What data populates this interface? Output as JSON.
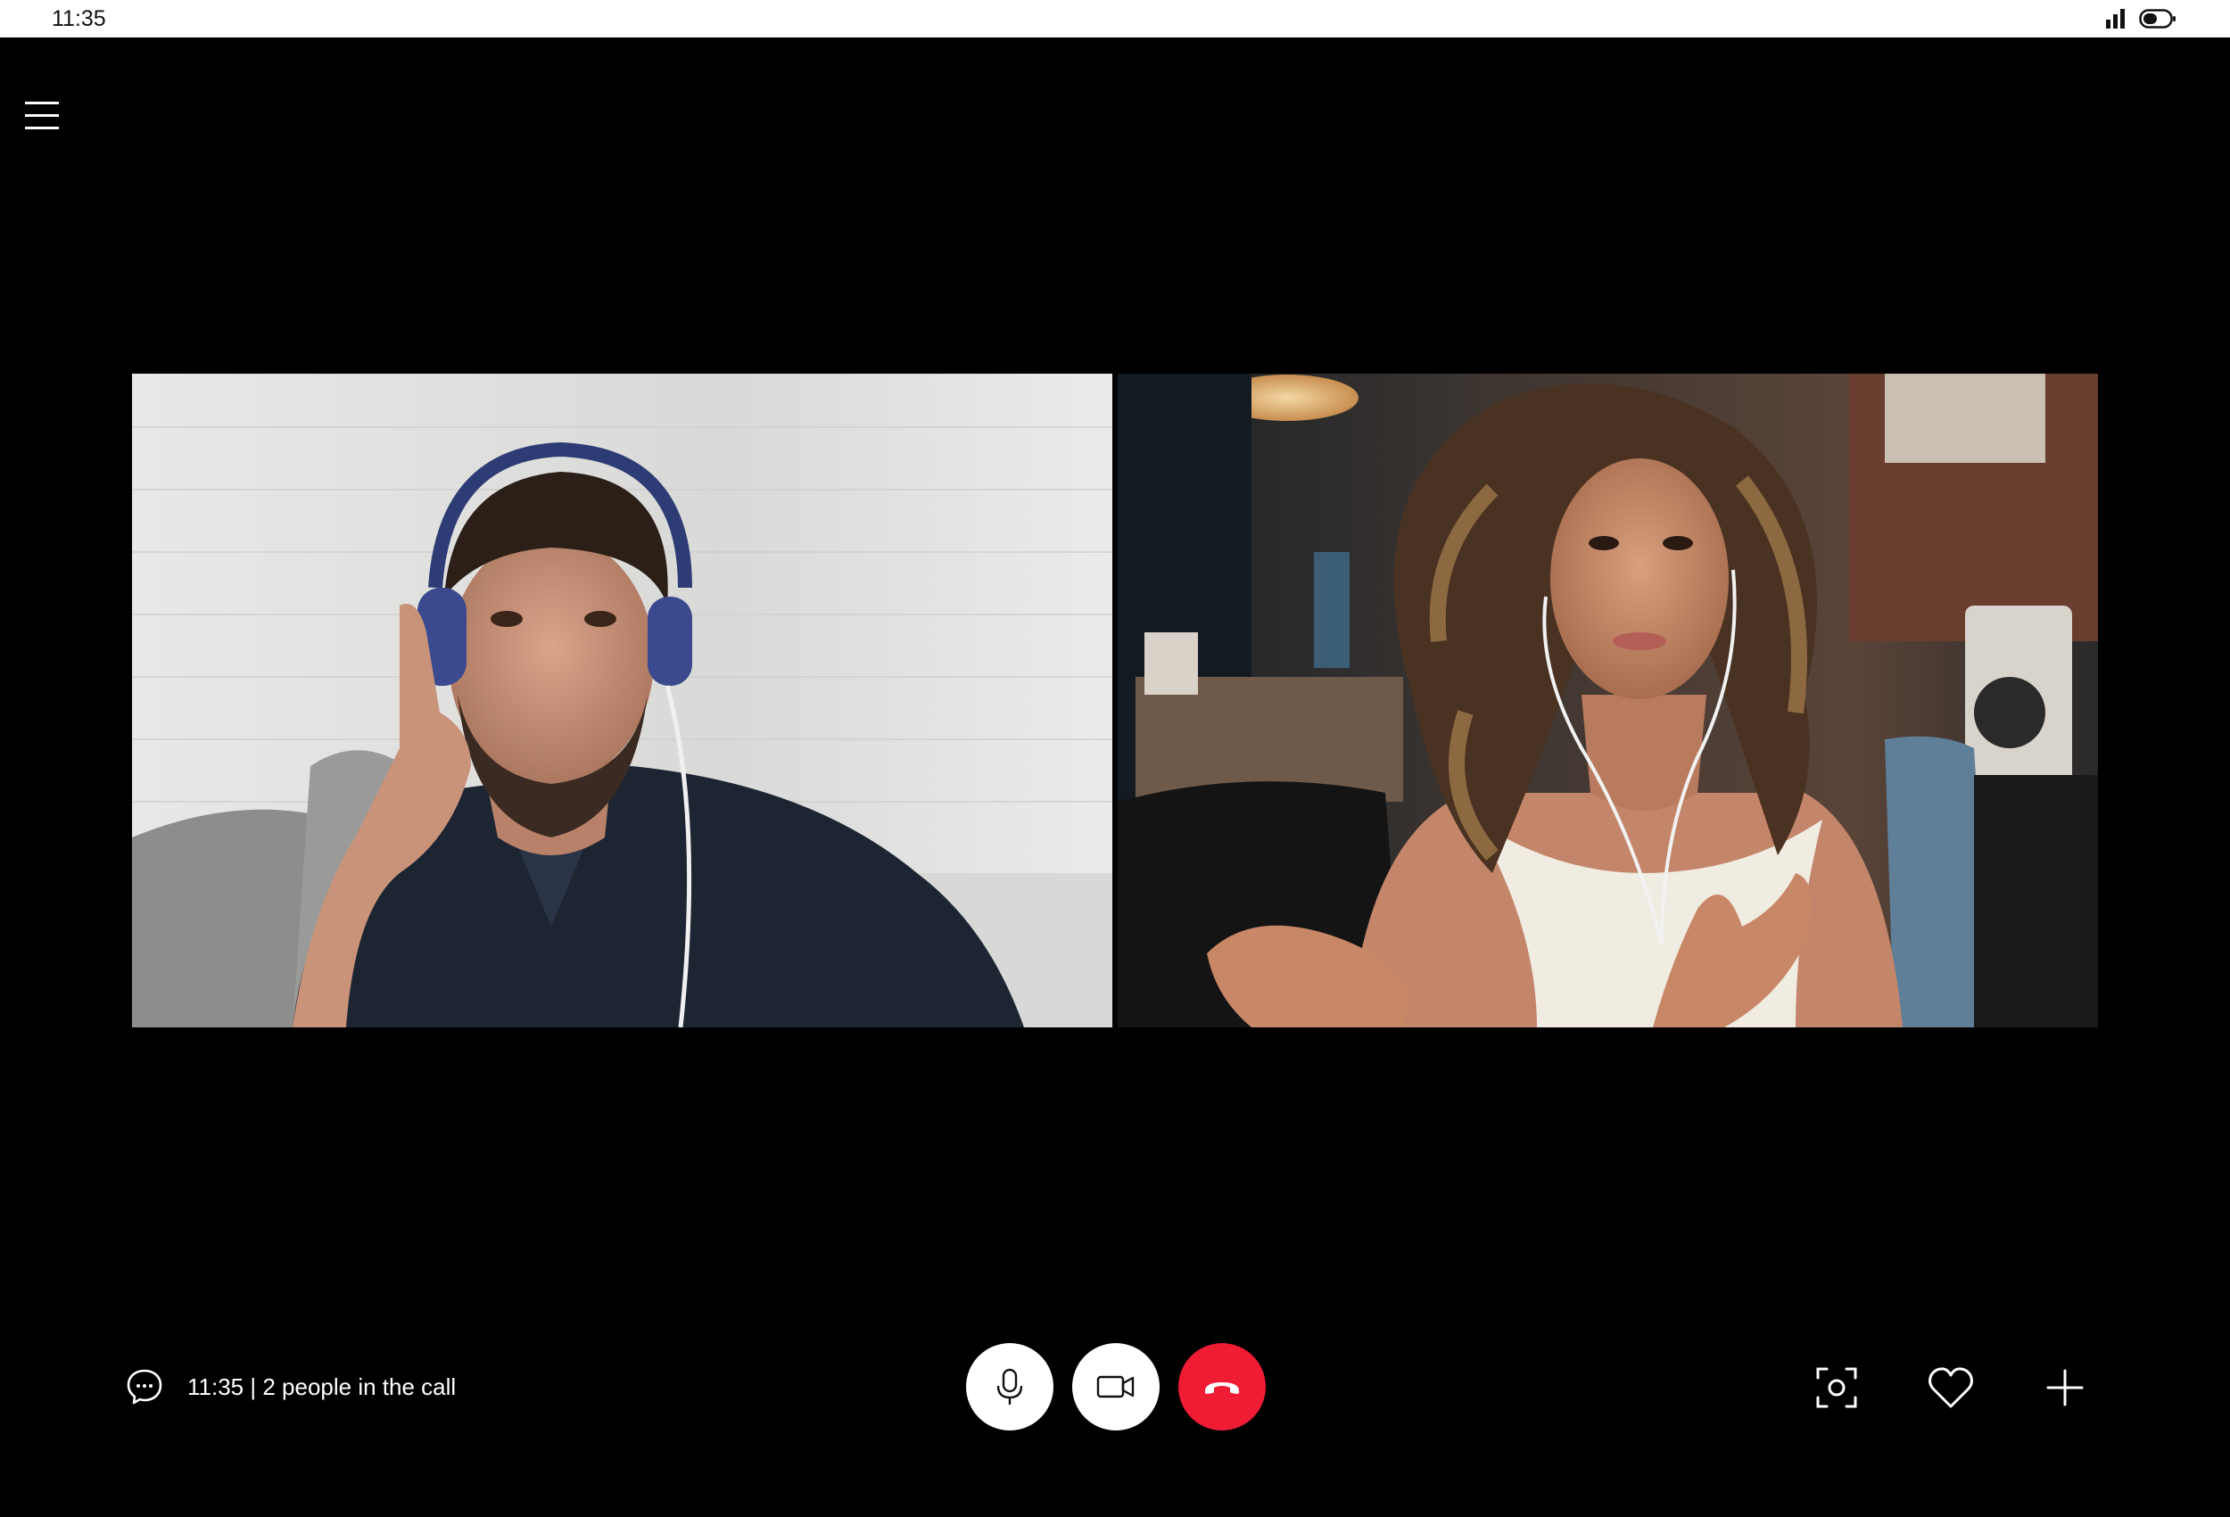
{
  "status_bar": {
    "time": "11:35",
    "signal_icon": "signal-bars-icon",
    "battery_icon": "battery-icon"
  },
  "menu": {
    "icon": "hamburger-menu-icon"
  },
  "participants": [
    {
      "description": "man-with-headphones",
      "background": "white-brick-wall"
    },
    {
      "description": "woman-with-earphones",
      "background": "cafe-interior"
    }
  ],
  "call_info": {
    "icon": "chat-bubble-icon",
    "status_text": "11:35 | 2 people in the call"
  },
  "controls": {
    "mic_icon": "microphone-icon",
    "video_icon": "video-camera-icon",
    "hangup_icon": "phone-hangup-icon",
    "screenshot_icon": "screenshot-camera-icon",
    "react_icon": "heart-icon",
    "add_icon": "plus-icon"
  },
  "colors": {
    "background": "#000000",
    "status_bar": "#ffffff",
    "hangup": "#f01c34",
    "control_button": "#ffffff"
  }
}
